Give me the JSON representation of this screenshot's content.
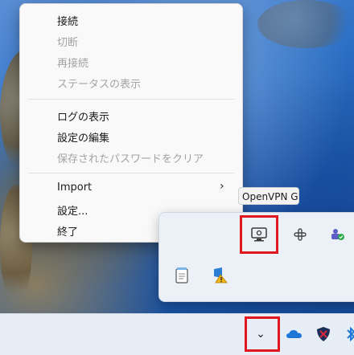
{
  "context_menu": {
    "items": [
      {
        "label": "接続",
        "enabled": true
      },
      {
        "label": "切断",
        "enabled": false
      },
      {
        "label": "再接続",
        "enabled": false
      },
      {
        "label": "ステータスの表示",
        "enabled": false
      },
      {
        "label": "ログの表示",
        "enabled": true
      },
      {
        "label": "設定の編集",
        "enabled": true
      },
      {
        "label": "保存されたパスワードをクリア",
        "enabled": false
      },
      {
        "label": "Import",
        "enabled": true,
        "has_submenu": true
      },
      {
        "label": "設定...",
        "enabled": true
      },
      {
        "label": "終了",
        "enabled": true
      }
    ],
    "submenu_arrow": "›"
  },
  "tooltip": {
    "text": "OpenVPN GUI"
  },
  "tray": {
    "icons": [
      {
        "name": "openvpn-gui-icon",
        "highlighted": true
      },
      {
        "name": "slack-icon"
      },
      {
        "name": "teams-icon"
      },
      {
        "name": "notepad-icon"
      },
      {
        "name": "shield-warning-icon"
      }
    ]
  },
  "taskbar": {
    "chevron_symbol": "⌄",
    "icons": [
      "onedrive-icon",
      "vpn-shield-icon",
      "bluetooth-icon"
    ]
  },
  "colors": {
    "highlight": "#e0181e",
    "menu_bg": "#f9f9f9",
    "disabled_text": "#a3a3a3"
  }
}
